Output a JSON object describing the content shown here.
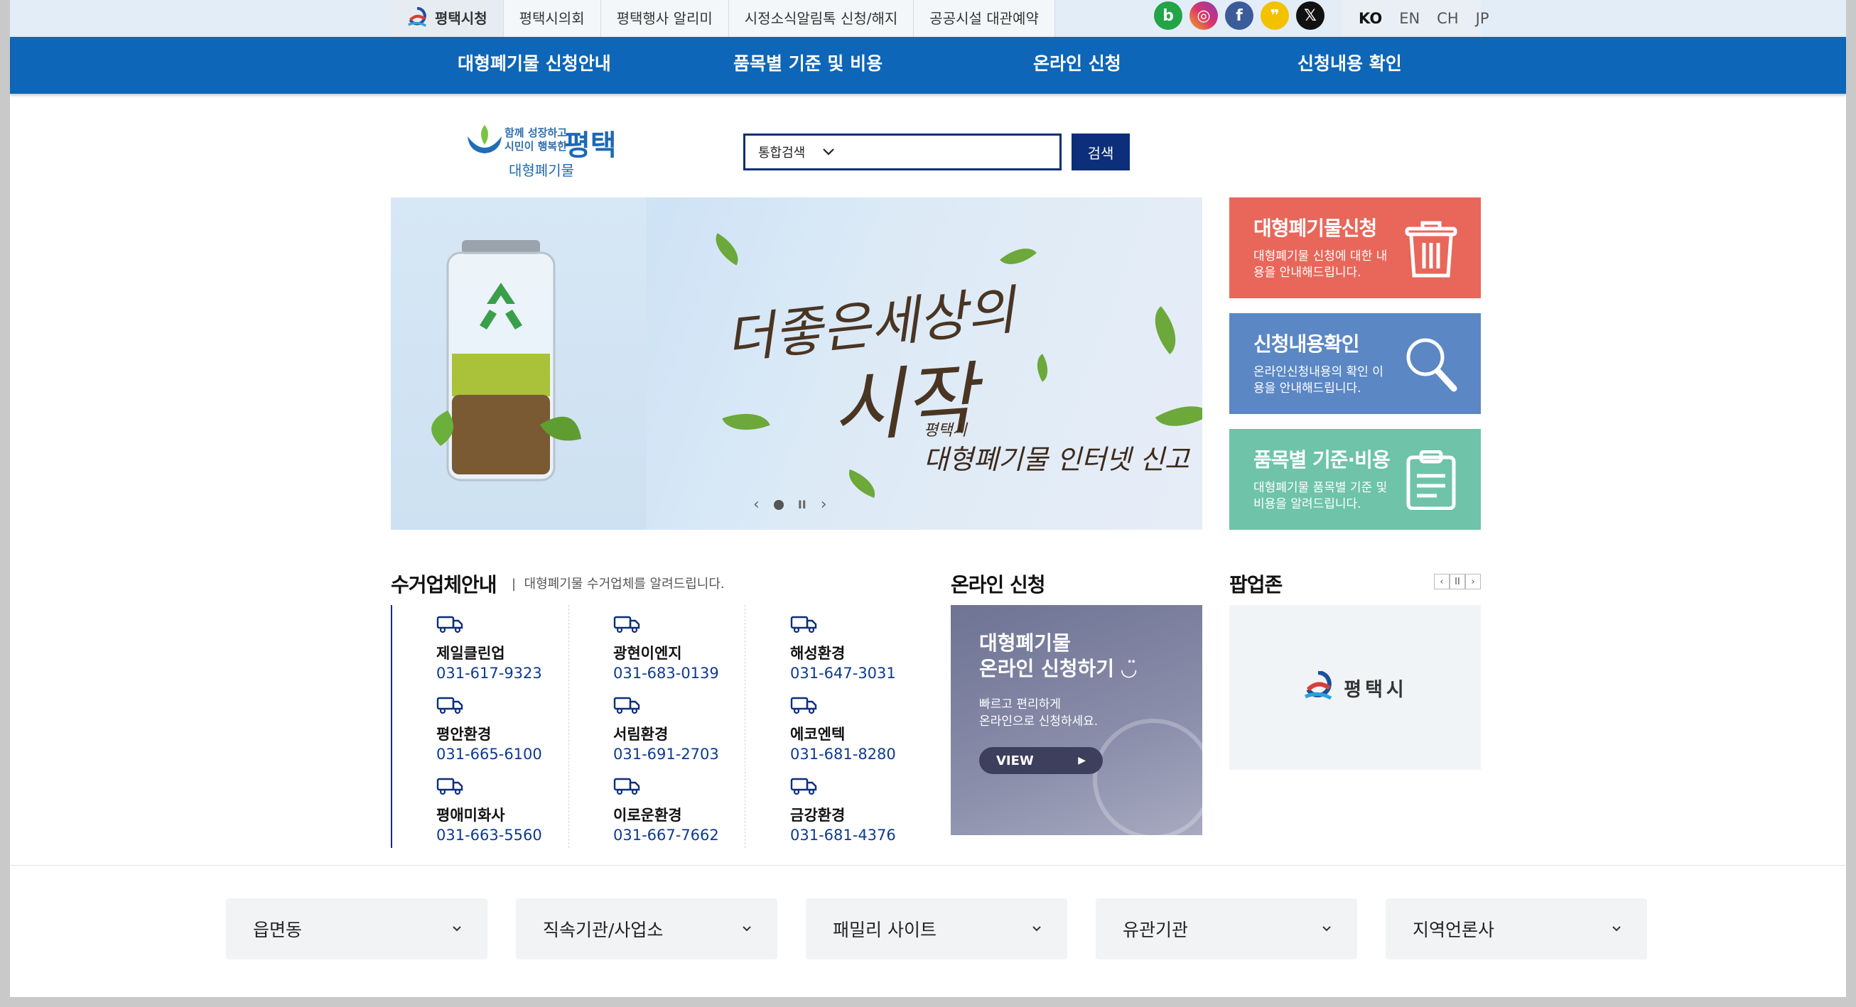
{
  "top_links": [
    "평택시청",
    "평택시의회",
    "평택행사 알리미",
    "시정소식알림톡 신청/해지",
    "공공시설 대관예약"
  ],
  "social_icons": [
    {
      "name": "blog-icon",
      "glyph": "b",
      "color": "#22a447"
    },
    {
      "name": "instagram-icon",
      "glyph": "◎",
      "color": "#d8346b"
    },
    {
      "name": "facebook-icon",
      "glyph": "f",
      "color": "#3b5b9a"
    },
    {
      "name": "kakao-icon",
      "glyph": "❞",
      "color": "#f2c200"
    },
    {
      "name": "x-icon",
      "glyph": "𝕏",
      "color": "#111111"
    }
  ],
  "languages": [
    "KO",
    "EN",
    "CH",
    "JP"
  ],
  "main_nav": [
    "대형폐기물 신청안내",
    "품목별 기준 및 비용",
    "온라인 신청",
    "신청내용 확인"
  ],
  "logo": {
    "tag1": "함께 성장하고",
    "tag2": "시민이 행복한",
    "city": "평택",
    "sub": "대형폐기물"
  },
  "search": {
    "select_label": "통합검색",
    "button_label": "검색"
  },
  "banner": {
    "calligraphy1": "더좋은세상의",
    "calligraphy2": "시작",
    "caption_small": "평택시",
    "caption_large": "대형폐기물 인터넷 신고"
  },
  "tiles": [
    {
      "title": "대형폐기물신청",
      "desc": "대형폐기물 신청에 대한 내용을 안내해드립니다.",
      "color": "#e8675a"
    },
    {
      "title": "신청내용확인",
      "desc": "온라인신청내용의 확인 이용을 안내해드립니다.",
      "color": "#5b87c4"
    },
    {
      "title": "품목별 기준·비용",
      "desc": "대형폐기물 품목별 기준 및 비용을 알려드립니다.",
      "color": "#6ec3a8"
    }
  ],
  "companies_section": {
    "title": "수거업체안내",
    "subtitle": "대형폐기물 수거업체를 알려드립니다."
  },
  "companies": [
    {
      "name": "제일클린업",
      "phone": "031-617-9323"
    },
    {
      "name": "광현이엔지",
      "phone": "031-683-0139"
    },
    {
      "name": "해성환경",
      "phone": "031-647-3031"
    },
    {
      "name": "평안환경",
      "phone": "031-665-6100"
    },
    {
      "name": "서림환경",
      "phone": "031-691-2703"
    },
    {
      "name": "에코엔텍",
      "phone": "031-681-8280"
    },
    {
      "name": "평애미화사",
      "phone": "031-663-5560"
    },
    {
      "name": "이로운환경",
      "phone": "031-667-7662"
    },
    {
      "name": "금강환경",
      "phone": "031-681-4376"
    }
  ],
  "online_section": {
    "title": "온라인 신청",
    "line1": "대형폐기물",
    "line2": "온라인 신청하기 ◡̈",
    "desc1": "빠르고 편리하게",
    "desc2": "온라인으로 신청하세요.",
    "button": "VIEW"
  },
  "popup_section": {
    "title": "팝업존",
    "logo_text": "평택시"
  },
  "footer_selects": [
    "읍면동",
    "직속기관/사업소",
    "패밀리 사이트",
    "유관기관",
    "지역언론사"
  ]
}
